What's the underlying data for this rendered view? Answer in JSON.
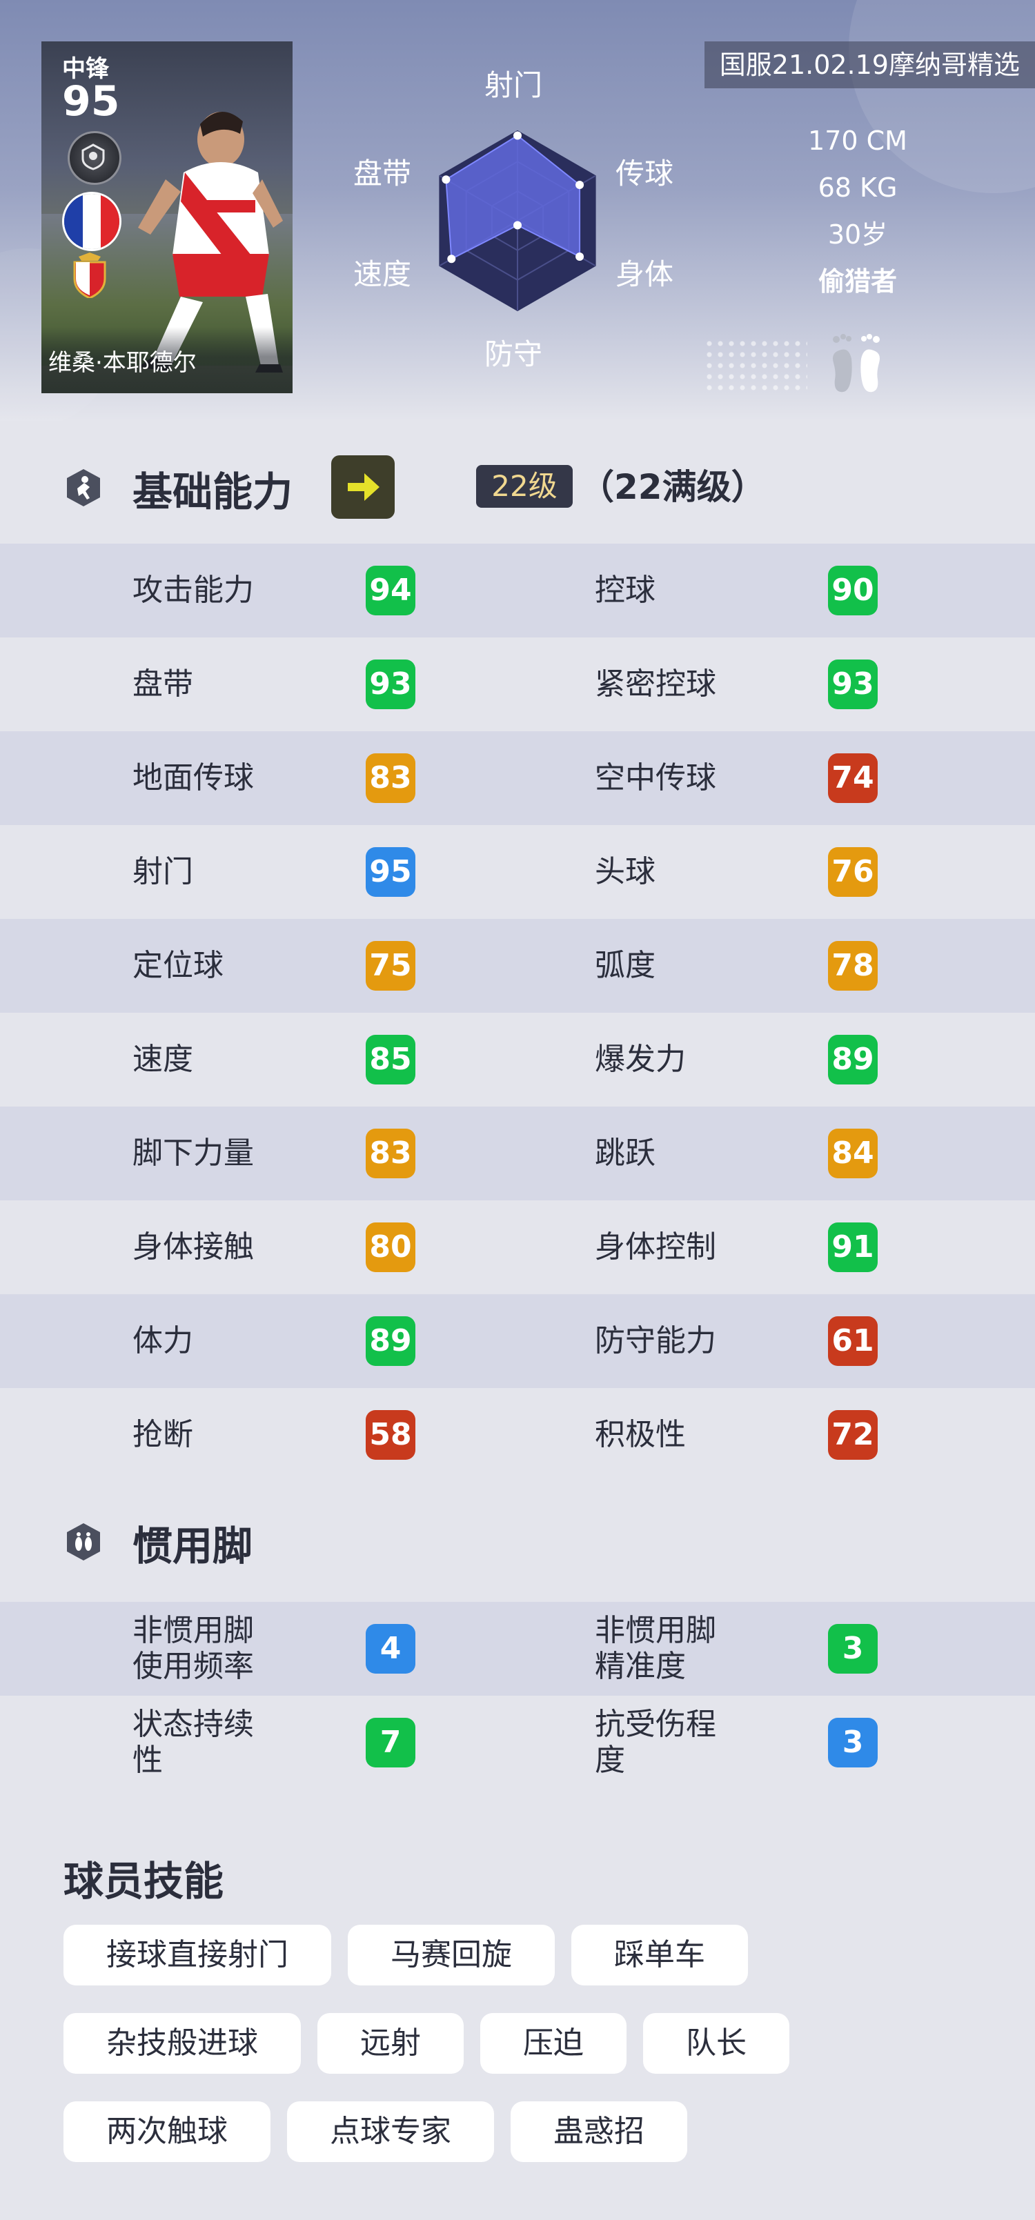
{
  "header": {
    "top_tag": "国服21.02.19摩纳哥精选",
    "card": {
      "position": "中锋",
      "rating": "95",
      "name": "维桑·本耶德尔",
      "flag_colors": [
        "#1f3fa8",
        "#ffffff",
        "#e0262b"
      ]
    },
    "radar": {
      "labels": {
        "top": "射门",
        "top_left": "盘带",
        "top_right": "传球",
        "bottom_left": "速度",
        "bottom_right": "身体",
        "bottom": "防守"
      },
      "values": {
        "shooting": 0.95,
        "passing": 0.8,
        "physical": 0.8,
        "defense": 0.05,
        "speed": 0.85,
        "dribbling": 0.92
      }
    },
    "physical": {
      "height": "170 CM",
      "weight": "68 KG",
      "age": "30岁",
      "play_style": "偷猎者"
    }
  },
  "basic": {
    "title": "基础能力",
    "level": "22级",
    "max_level": "（22满级）",
    "rows": [
      [
        {
          "label": "攻击能力",
          "value": "94",
          "color": "green"
        },
        {
          "label": "控球",
          "value": "90",
          "color": "green"
        }
      ],
      [
        {
          "label": "盘带",
          "value": "93",
          "color": "green"
        },
        {
          "label": "紧密控球",
          "value": "93",
          "color": "green"
        }
      ],
      [
        {
          "label": "地面传球",
          "value": "83",
          "color": "orange"
        },
        {
          "label": "空中传球",
          "value": "74",
          "color": "red"
        }
      ],
      [
        {
          "label": "射门",
          "value": "95",
          "color": "blue"
        },
        {
          "label": "头球",
          "value": "76",
          "color": "orange"
        }
      ],
      [
        {
          "label": "定位球",
          "value": "75",
          "color": "orange"
        },
        {
          "label": "弧度",
          "value": "78",
          "color": "orange"
        }
      ],
      [
        {
          "label": "速度",
          "value": "85",
          "color": "green"
        },
        {
          "label": "爆发力",
          "value": "89",
          "color": "green"
        }
      ],
      [
        {
          "label": "脚下力量",
          "value": "83",
          "color": "orange"
        },
        {
          "label": "跳跃",
          "value": "84",
          "color": "orange"
        }
      ],
      [
        {
          "label": "身体接触",
          "value": "80",
          "color": "orange"
        },
        {
          "label": "身体控制",
          "value": "91",
          "color": "green"
        }
      ],
      [
        {
          "label": "体力",
          "value": "89",
          "color": "green"
        },
        {
          "label": "防守能力",
          "value": "61",
          "color": "red"
        }
      ],
      [
        {
          "label": "抢断",
          "value": "58",
          "color": "red"
        },
        {
          "label": "积极性",
          "value": "72",
          "color": "red"
        }
      ]
    ]
  },
  "foot": {
    "title": "惯用脚",
    "rows": [
      [
        {
          "label": "非惯用脚\n使用频率",
          "value": "4",
          "color": "blue"
        },
        {
          "label": "非惯用脚\n精准度",
          "value": "3",
          "color": "green"
        }
      ],
      [
        {
          "label": "状态持续\n性",
          "value": "7",
          "color": "green"
        },
        {
          "label": "抗受伤程\n度",
          "value": "3",
          "color": "blue"
        }
      ]
    ]
  },
  "skills": {
    "title": "球员技能",
    "rows": [
      [
        "接球直接射门",
        "马赛回旋",
        "踩单车"
      ],
      [
        "杂技般进球",
        "远射",
        "压迫",
        "队长"
      ],
      [
        "两次触球",
        "点球专家",
        "蛊惑招"
      ]
    ]
  }
}
